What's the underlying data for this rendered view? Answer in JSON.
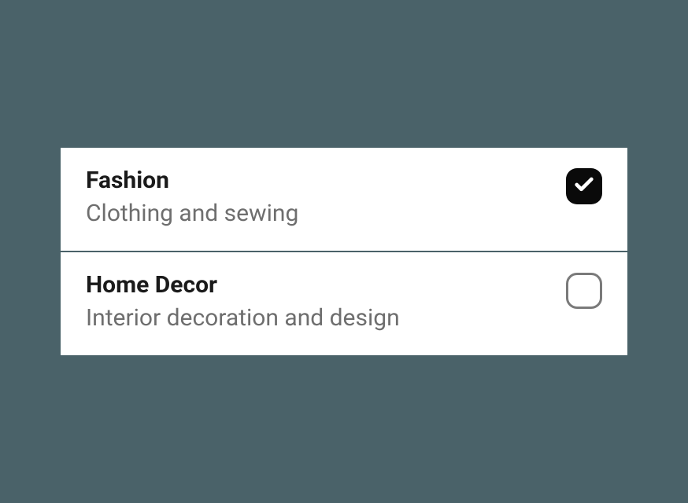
{
  "items": [
    {
      "title": "Fashion",
      "subtitle": "Clothing and sewing",
      "checked": true
    },
    {
      "title": "Home Decor",
      "subtitle": "Interior decoration and design",
      "checked": false
    }
  ]
}
